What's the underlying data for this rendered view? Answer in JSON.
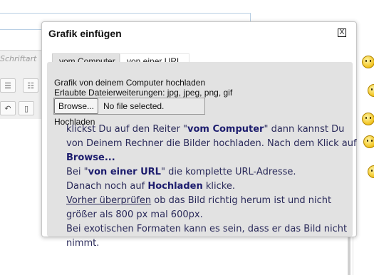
{
  "background": {
    "font_placeholder": "Schriftart",
    "toolbar_icons": [
      "align-right-icon",
      "list-icon",
      "undo-icon",
      "copy-icon"
    ]
  },
  "dialog": {
    "title": "Grafik einfügen",
    "close_label": "X",
    "tabs": [
      {
        "label": "vom Computer",
        "active": true
      },
      {
        "label": "von einer URL",
        "active": false
      }
    ],
    "upload_heading": "Grafik von deinem Computer hochladen",
    "allowed_extensions": "Erlaubte Dateierweiterungen: jpg, jpeg, png, gif",
    "browse_label": "Browse...",
    "file_status": "No file selected.",
    "upload_label": "Hochladen"
  },
  "help": {
    "p1_a": "klickst Du auf den Reiter \"",
    "p1_b": "vom Computer",
    "p1_c": "\" dann kannst Du von Deinem Rechner die Bilder hochladen. Nach dem Klick auf ",
    "p1_d": "Browse...",
    "p2_a": "Bei \"",
    "p2_b": "von einer URL",
    "p2_c": "\" die komplette URL-Adresse.",
    "p3_a": "Danach noch auf ",
    "p3_b": "Hochladen",
    "p3_c": " klicke.",
    "p4_a": "Vorher überprüfen",
    "p4_b": " ob das Bild richtig herum ist und nicht größer als 800 px mal 600px.",
    "p5": "Bei exotischen Formaten kann es sein, dass er das Bild nicht nimmt."
  }
}
